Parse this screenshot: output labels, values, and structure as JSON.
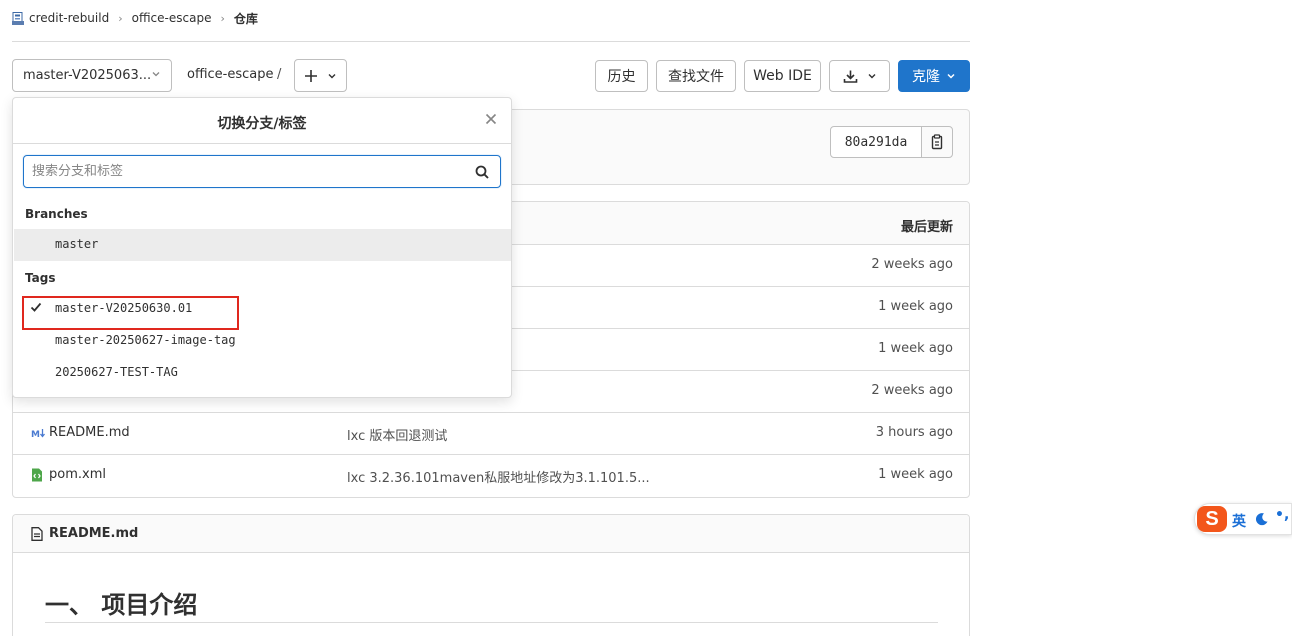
{
  "breadcrumb": {
    "items": [
      "credit-rebuild",
      "office-escape",
      "仓库"
    ]
  },
  "toolbar": {
    "branch_selected": "master-V2025063...",
    "path": "office-escape",
    "path_sep": "/",
    "history": "历史",
    "find_file": "查找文件",
    "web_ide": "Web IDE",
    "clone": "克隆"
  },
  "commit": {
    "sha": "80a291da"
  },
  "files": {
    "header_last_update": "最后更新",
    "rows": [
      {
        "name": "",
        "message": "",
        "time": "2 weeks ago"
      },
      {
        "name": "",
        "message": "",
        "time": "1 week ago"
      },
      {
        "name": "",
        "message": "",
        "time": "1 week ago"
      },
      {
        "name": "",
        "message": "",
        "time": "2 weeks ago"
      },
      {
        "name": "README.md",
        "message": "lxc 版本回退测试",
        "time": "3 hours ago"
      },
      {
        "name": "pom.xml",
        "message": "lxc 3.2.36.101maven私服地址修改为3.1.101.5...",
        "time": "1 week ago"
      }
    ]
  },
  "readme": {
    "title": "README.md",
    "heading": "一、 项目介绍"
  },
  "dropdown": {
    "title": "切换分支/标签",
    "search_placeholder": "搜索分支和标签",
    "branches_label": "Branches",
    "branches": [
      "master"
    ],
    "tags_label": "Tags",
    "tags": [
      "master-V20250630.01",
      "master-20250627-image-tag",
      "20250627-TEST-TAG"
    ],
    "selected_tag": "master-V20250630.01"
  },
  "ime": {
    "logo": "S",
    "lang": "英",
    "punct": "•,"
  },
  "colors": {
    "primary": "#1f75cb",
    "highlight_box": "#e0281e",
    "border": "#dbdbdb",
    "ime_logo": "#f3561b"
  }
}
